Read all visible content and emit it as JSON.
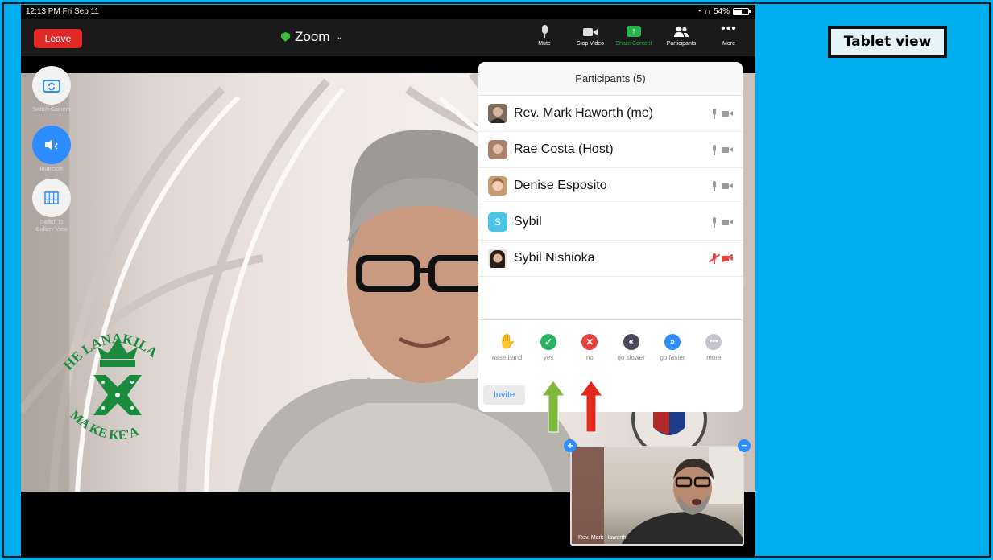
{
  "status_bar": {
    "time": "12:13 PM   Fri Sep 11",
    "battery": "54%"
  },
  "toolbar": {
    "leave_label": "Leave",
    "meeting_title": "Zoom",
    "buttons": [
      {
        "label": "Mute",
        "icon": "microphone-icon"
      },
      {
        "label": "Stop Video",
        "icon": "video-camera-icon"
      },
      {
        "label": "Share Content",
        "icon": "share-screen-icon"
      },
      {
        "label": "Participants",
        "icon": "participants-icon"
      },
      {
        "label": "More",
        "icon": "more-dots-icon"
      }
    ]
  },
  "float_controls": [
    {
      "label": "Switch Camera",
      "icon": "switch-camera-icon"
    },
    {
      "label": "Bluetooth",
      "icon": "speaker-icon"
    },
    {
      "label": "Switch to Gallery View",
      "icon": "gallery-grid-icon"
    }
  ],
  "participants": {
    "title": "Participants (5)",
    "list": [
      {
        "name": "Rev. Mark Haworth (me)",
        "muted": false
      },
      {
        "name": "Rae Costa (Host)",
        "muted": false
      },
      {
        "name": "Denise Esposito",
        "muted": false
      },
      {
        "name": "Sybil",
        "initial": "S",
        "muted": false
      },
      {
        "name": "Sybil Nishioka",
        "muted": true
      }
    ],
    "feedback": [
      {
        "label": "raise hand",
        "color": "#2d8cff"
      },
      {
        "label": "yes",
        "color": "#28b463"
      },
      {
        "label": "no",
        "color": "#e8403a"
      },
      {
        "label": "go slower",
        "color": "#4a4a5a"
      },
      {
        "label": "go faster",
        "color": "#2d8cff"
      },
      {
        "label": "more",
        "color": "#c5c5d2"
      }
    ],
    "invite_label": "Invite"
  },
  "logo": {
    "top_text": "HE LANAKILA",
    "bottom_text": "MA KE KE'A",
    "color": "#1a8a3c"
  },
  "self_view": {
    "name": "Rev. Mark Haworth"
  },
  "slide_label": "Tablet view",
  "colors": {
    "background": "#00aeef",
    "zoom_blue": "#2d8cff",
    "leave_red": "#e02828"
  }
}
